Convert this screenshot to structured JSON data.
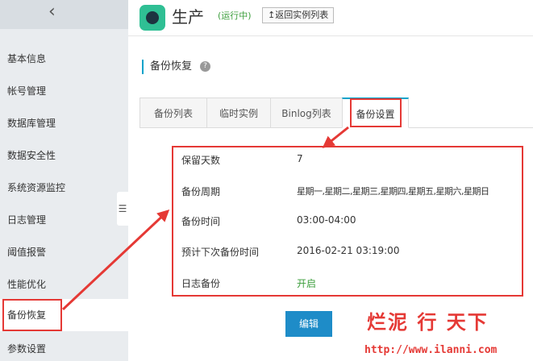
{
  "sidebar": {
    "collapse_glyph": "‹",
    "items": [
      {
        "label": "基本信息"
      },
      {
        "label": "帐号管理"
      },
      {
        "label": "数据库管理"
      },
      {
        "label": "数据安全性"
      },
      {
        "label": "系统资源监控"
      },
      {
        "label": "日志管理"
      },
      {
        "label": "阈值报警"
      },
      {
        "label": "性能优化"
      },
      {
        "label": "备份恢复",
        "active": true
      },
      {
        "label": "参数设置"
      }
    ],
    "handle_glyph": "☰"
  },
  "header": {
    "title": "生产",
    "status": "(运行中)",
    "back_button": "↥返回实例列表"
  },
  "section": {
    "title": "备份恢复",
    "help": "?"
  },
  "tabs": [
    {
      "label": "备份列表"
    },
    {
      "label": "临时实例"
    },
    {
      "label": "Binlog列表"
    },
    {
      "label": "备份设置",
      "active": true
    }
  ],
  "settings": {
    "retention_label": "保留天数",
    "retention_value": "7",
    "cycle_label": "备份周期",
    "cycle_value": "星期一,星期二,星期三,星期四,星期五,星期六,星期日",
    "time_label": "备份时间",
    "time_value": "03:00-04:00",
    "next_label": "预计下次备份时间",
    "next_value": "2016-02-21 03:19:00",
    "log_label": "日志备份",
    "log_value": "开启"
  },
  "edit_button": "编辑",
  "watermark": {
    "text": "烂泥 行 天下",
    "url": "http://www.ilanni.com"
  },
  "colors": {
    "accent": "#00a2ca",
    "annotation": "#e53935",
    "status_green": "#3c9e3c",
    "button_blue": "#1e8cc8"
  }
}
